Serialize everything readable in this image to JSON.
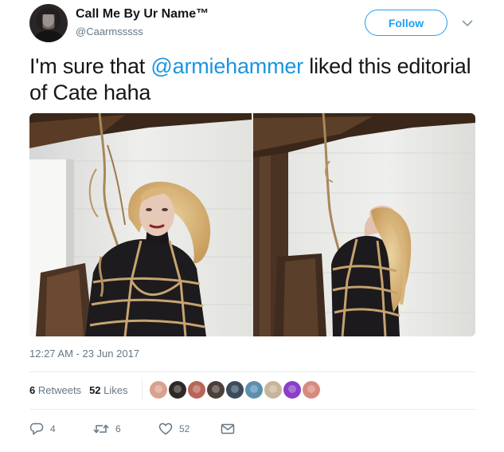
{
  "user": {
    "display_name": "Call Me By Ur Name™",
    "screen_name": "@Caarmsssss",
    "avatar_icon": "user-avatar"
  },
  "follow": {
    "label": "Follow"
  },
  "menu": {
    "icon": "chevron-down-icon"
  },
  "tweet": {
    "text_before": "I'm sure that ",
    "mention": "@armiehammer",
    "text_after": " liked this editorial of Cate haha"
  },
  "media": {
    "count": 2
  },
  "timestamp": "12:27 AM - 23 Jun 2017",
  "stats": {
    "retweets_count": "6",
    "retweets_label": "Retweets",
    "likes_count": "52",
    "likes_label": "Likes",
    "liker_avatar_colors": [
      "#d9a090",
      "#2f2a28",
      "#b8655a",
      "#4a3f3a",
      "#3b4a5c",
      "#5a8fb0",
      "#c7b49a",
      "#8a3fc8",
      "#d88a7f"
    ]
  },
  "actions": {
    "reply": {
      "icon": "reply-icon",
      "count": "4"
    },
    "retweet": {
      "icon": "retweet-icon",
      "count": "6"
    },
    "like": {
      "icon": "heart-icon",
      "count": "52"
    },
    "dm": {
      "icon": "envelope-icon"
    }
  },
  "colors": {
    "accent": "#1da1f2",
    "mention": "#1b95e0",
    "secondary_text": "#657786",
    "divider": "#e6ecf0"
  }
}
